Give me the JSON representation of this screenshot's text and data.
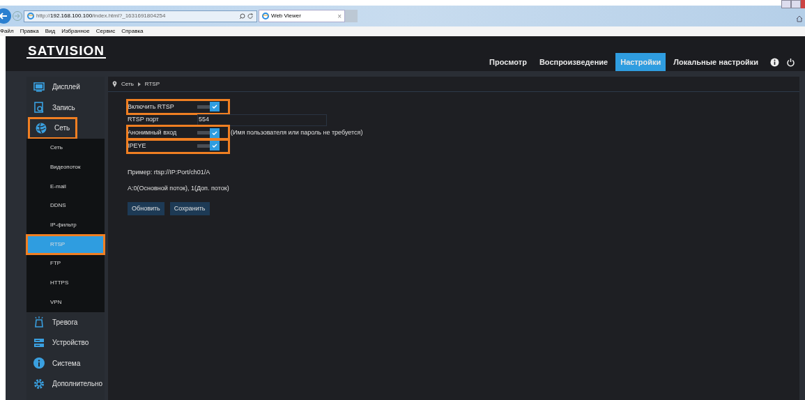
{
  "browser": {
    "url_prefix": "http://",
    "url_host": "192.168.100.100",
    "url_path": "/index.html?_1631691804254",
    "tab_title": "Web Viewer",
    "tab_close": "×",
    "menu": [
      "Файл",
      "Правка",
      "Вид",
      "Избранное",
      "Сервис",
      "Справка"
    ]
  },
  "header": {
    "logo": "SATVISION",
    "nav": [
      {
        "label": "Просмотр",
        "selected": false
      },
      {
        "label": "Воспроизведение",
        "selected": false
      },
      {
        "label": "Настройки",
        "selected": true
      },
      {
        "label": "Локальные настройки",
        "selected": false
      }
    ]
  },
  "sidebar": [
    {
      "label": "Дисплей",
      "highlighted": false
    },
    {
      "label": "Запись",
      "highlighted": false
    },
    {
      "label": "Сеть",
      "highlighted": true,
      "children": [
        {
          "label": "Сеть",
          "selected": false,
          "highlighted": false
        },
        {
          "label": "Видеопоток",
          "selected": false,
          "highlighted": false
        },
        {
          "label": "E-mail",
          "selected": false,
          "highlighted": false
        },
        {
          "label": "DDNS",
          "selected": false,
          "highlighted": false
        },
        {
          "label": "IP-фильтр",
          "selected": false,
          "highlighted": false
        },
        {
          "label": "RTSP",
          "selected": true,
          "highlighted": true
        },
        {
          "label": "FTP",
          "selected": false,
          "highlighted": false
        },
        {
          "label": "HTTPS",
          "selected": false,
          "highlighted": false
        },
        {
          "label": "VPN",
          "selected": false,
          "highlighted": false
        }
      ]
    },
    {
      "label": "Тревога",
      "highlighted": false
    },
    {
      "label": "Устройство",
      "highlighted": false
    },
    {
      "label": "Система",
      "highlighted": false
    },
    {
      "label": "Дополнительно",
      "highlighted": false
    }
  ],
  "breadcrumb": [
    "Сеть",
    "RTSP"
  ],
  "form": [
    {
      "kind": "toggle",
      "label": "Включить RTSP",
      "checked": true,
      "highlighted": true
    },
    {
      "kind": "text",
      "label": "RTSP порт",
      "value": "554",
      "highlighted": false
    },
    {
      "kind": "toggle",
      "label": "Анонимный вход",
      "checked": true,
      "highlighted": true,
      "hint": "(Имя пользователя или пароль не требуется)"
    },
    {
      "kind": "toggle",
      "label": "IPEYE",
      "checked": true,
      "highlighted": true
    }
  ],
  "notes": [
    "Пример: rtsp://IP:Port/ch01/A",
    "A:0(Основной поток), 1(Доп. поток)"
  ],
  "buttons": [
    "Обновить",
    "Сохранить"
  ]
}
